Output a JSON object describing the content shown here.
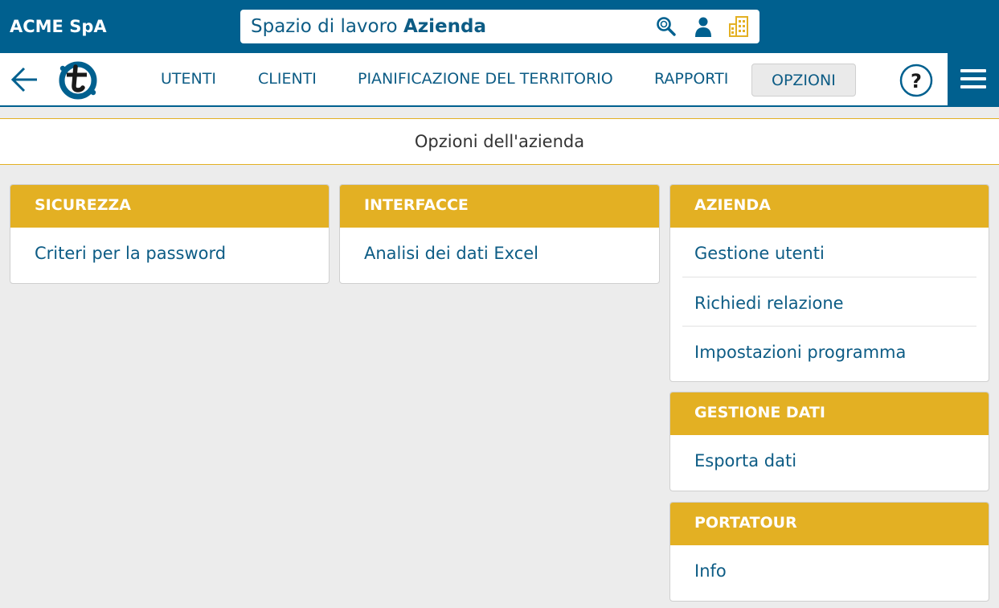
{
  "header": {
    "company": "ACME SpA",
    "workspace_prefix": "Spazio di lavoro",
    "workspace_name": "Azienda",
    "icons": [
      "search-icon",
      "user-icon",
      "building-icon"
    ]
  },
  "nav": {
    "items": [
      {
        "label": "UTENTI"
      },
      {
        "label": "CLIENTI"
      },
      {
        "label": "PIANIFICAZIONE DEL TERRITORIO"
      },
      {
        "label": "RAPPORTI"
      },
      {
        "label": "OPZIONI",
        "active": true
      }
    ],
    "help": "?"
  },
  "page": {
    "title": "Opzioni dell'azienda"
  },
  "cards": {
    "sicurezza": {
      "title": "SICUREZZA",
      "items": [
        "Criteri per la password"
      ]
    },
    "interfacce": {
      "title": "INTERFACCE",
      "items": [
        "Analisi dei dati Excel"
      ]
    },
    "azienda": {
      "title": "AZIENDA",
      "items": [
        "Gestione utenti",
        "Richiedi relazione",
        "Impostazioni programma"
      ]
    },
    "gestione_dati": {
      "title": "GESTIONE DATI",
      "items": [
        "Esporta dati"
      ]
    },
    "portatour": {
      "title": "PORTATOUR",
      "items": [
        "Info"
      ]
    }
  },
  "colors": {
    "primary": "#00608f",
    "accent": "#e3b023",
    "link": "#0d5c85",
    "background": "#ececec"
  }
}
